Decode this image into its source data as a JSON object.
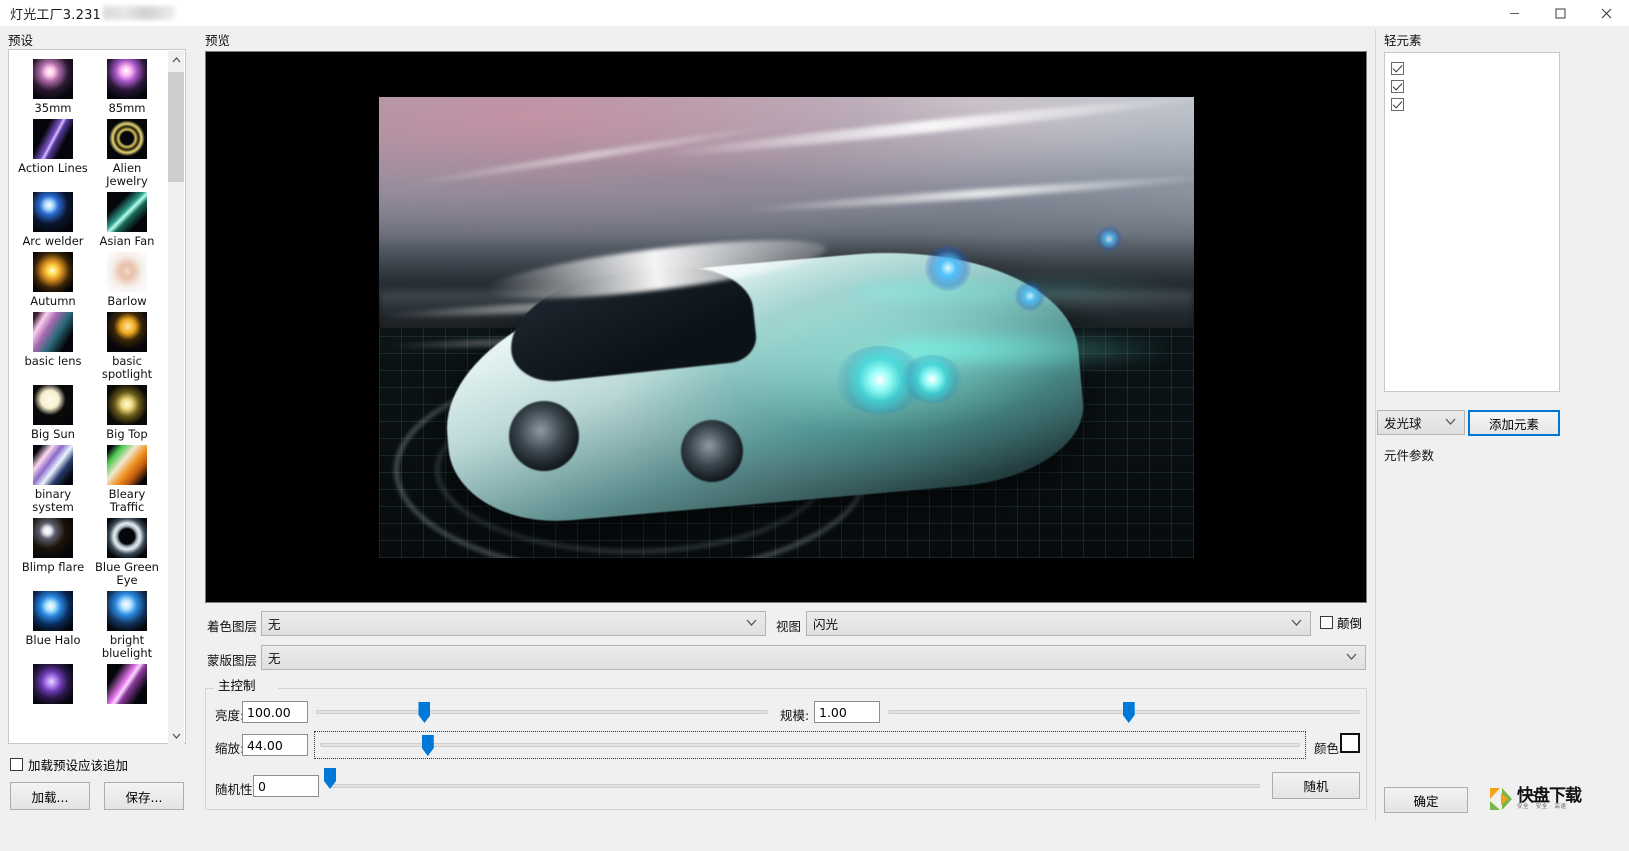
{
  "window": {
    "title": "灯光工厂3.231",
    "minimize_label": "–",
    "maximize_label": "□",
    "close_label": "✕"
  },
  "panels": {
    "preset_caption": "预设",
    "preview_caption": "预览",
    "elements_caption": "轻元素",
    "element_params_caption": "元件参数",
    "main_control_caption": "主控制"
  },
  "presets": {
    "items": [
      {
        "name": "35mm",
        "thumb": "lens-pink-flare"
      },
      {
        "name": "85mm",
        "thumb": "lens-magenta-flare"
      },
      {
        "name": "Action Lines",
        "thumb": "purple-streak"
      },
      {
        "name": "Alien Jewelry",
        "thumb": "gold-ring"
      },
      {
        "name": "Arc welder",
        "thumb": "blue-point"
      },
      {
        "name": "Asian Fan",
        "thumb": "green-diagonal"
      },
      {
        "name": "Autumn",
        "thumb": "yellow-starburst"
      },
      {
        "name": "Barlow",
        "thumb": "soft-orange-blur"
      },
      {
        "name": "basic lens",
        "thumb": "pink-lens"
      },
      {
        "name": "basic spotlight",
        "thumb": "small-amber-dot"
      },
      {
        "name": "Big Sun",
        "thumb": "cream-disc"
      },
      {
        "name": "Big Top",
        "thumb": "yellow-glow"
      },
      {
        "name": "binary system",
        "thumb": "twin-star"
      },
      {
        "name": "Bleary Traffic",
        "thumb": "orange-green-streak"
      },
      {
        "name": "Blimp flare",
        "thumb": "white-spark"
      },
      {
        "name": "Blue Green Eye",
        "thumb": "dark-ring-eye"
      },
      {
        "name": "Blue Halo",
        "thumb": "blue-halo-star"
      },
      {
        "name": "bright bluelight",
        "thumb": "blue-beam"
      },
      {
        "name": "",
        "thumb": "violet-ring"
      },
      {
        "name": "",
        "thumb": "magenta-streak"
      }
    ],
    "append_on_load_label": "加载预设应该追加",
    "append_on_load_checked": false,
    "load_button": "加载...",
    "save_button": "保存..."
  },
  "form": {
    "tint_layer_label": "着色图层",
    "tint_layer_value": "无",
    "mask_layer_label": "蒙版图层",
    "mask_layer_value": "无",
    "view_label": "视图",
    "view_value": "闪光",
    "invert_label": "颠倒",
    "invert_checked": false
  },
  "main_control": {
    "brightness_label": "亮度:",
    "brightness_value": "100.00",
    "brightness_pct": 24,
    "scale_label": "规模:",
    "scale_value": "1.00",
    "scale_pct": 51,
    "zoom_label": "缩放:",
    "zoom_value": "44.00",
    "zoom_pct": 11,
    "random_label": "随机性:",
    "random_value": "0",
    "random_pct": 0,
    "color_label": "颜色:",
    "color_value": "#ffffff",
    "random_button": "随机"
  },
  "right_panel": {
    "elements": [
      {
        "label": "",
        "checked": true
      },
      {
        "label": "",
        "checked": true
      },
      {
        "label": "",
        "checked": true
      }
    ],
    "element_type_value": "发光球",
    "add_element_button": "添加元素",
    "ok_button": "确定"
  },
  "watermark": {
    "brand": "快盘下载",
    "tagline": "安全 · 安全 · 高速"
  },
  "colors": {
    "accent": "#0078d7",
    "window_bg": "#f0f0f0",
    "panel_bg": "#ffffff",
    "preview_bg": "#000000"
  }
}
